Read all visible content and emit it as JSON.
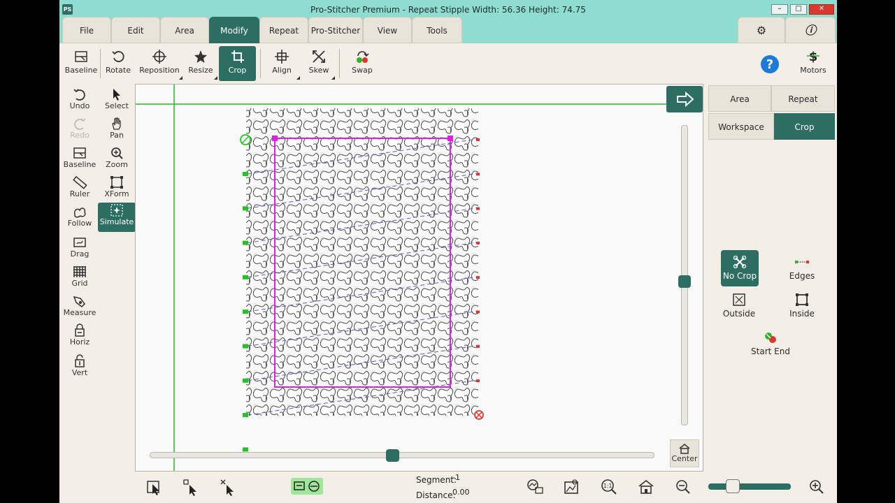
{
  "window": {
    "logo": "PS",
    "title": "Pro-Stitcher Premium   -  Repeat Stipple  Width: 56.36  Height: 74.75"
  },
  "menu": {
    "tabs": [
      "File",
      "Edit",
      "Area",
      "Modify",
      "Repeat",
      "Pro-Stitcher",
      "View",
      "Tools"
    ],
    "active": "Modify"
  },
  "toolbar": {
    "baseline": "Baseline",
    "rotate": "Rotate",
    "reposition": "Reposition",
    "resize": "Resize",
    "crop": "Crop",
    "align": "Align",
    "skew": "Skew",
    "swap": "Swap",
    "motors": "Motors"
  },
  "sidebar": {
    "undo": "Undo",
    "select": "Select",
    "redo": "Redo",
    "pan": "Pan",
    "baseline": "Baseline",
    "zoom": "Zoom",
    "ruler": "Ruler",
    "xform": "XForm",
    "follow": "Follow",
    "simulate": "Simulate",
    "drag": "Drag",
    "grid": "Grid",
    "measure": "Measure",
    "horiz": "Horiz",
    "vert": "Vert"
  },
  "right_panel": {
    "tabs_row1": [
      "Area",
      "Repeat"
    ],
    "tabs_row2": [
      "Workspace",
      "Crop"
    ],
    "active_tab": "Crop",
    "no_crop": "No Crop",
    "edges": "Edges",
    "outside": "Outside",
    "inside": "Inside",
    "start_end": "Start End"
  },
  "canvas": {
    "center_label": "Center",
    "vertical_slider_level": 0.52,
    "horizontal_slider_level": 0.48
  },
  "status": {
    "segment_label": "Segment:",
    "segment_value": "-1",
    "distance_label": "Distance:",
    "distance_value": "0.00",
    "zoom_level": 0.3
  },
  "colors": {
    "accent": "#2d6e62",
    "title_bar": "#8fdcd0",
    "crop_box": "#e020e0",
    "guide_line": "#2bb52b",
    "start_marker": "#22c322",
    "end_marker": "#d9382e"
  }
}
